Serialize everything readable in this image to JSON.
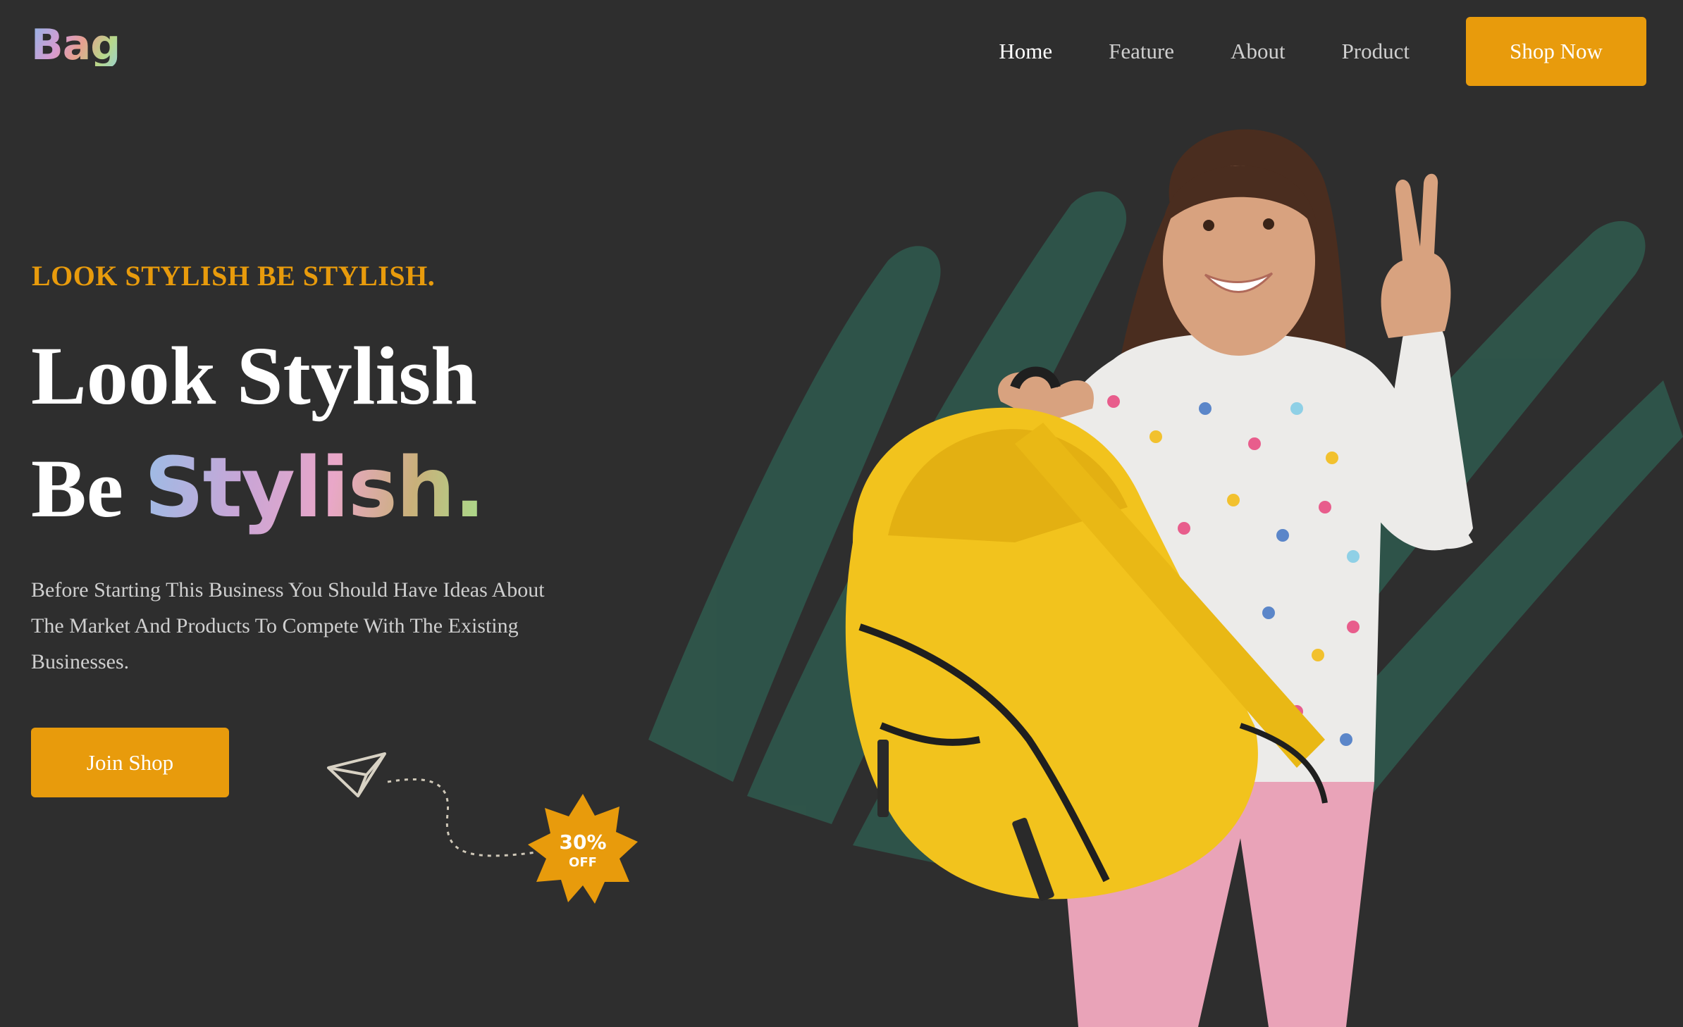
{
  "brand": {
    "logo_text": "Bag"
  },
  "nav": {
    "items": [
      {
        "label": "Home",
        "active": true
      },
      {
        "label": "Feature",
        "active": false
      },
      {
        "label": "About",
        "active": false
      },
      {
        "label": "Product",
        "active": false
      }
    ],
    "cta_label": "Shop Now"
  },
  "hero": {
    "eyebrow": "LOOK STYLISH BE STYLISH.",
    "headline_line1": "Look Stylish",
    "headline_line2_prefix": "Be",
    "headline_line2_gradient": "Stylish.",
    "description": "Before Starting This Business You Should Have Ideas About The Market And Products To Compete With The Existing Businesses.",
    "join_label": "Join Shop",
    "badge": {
      "percent": "30%",
      "label": "OFF"
    }
  },
  "colors": {
    "background": "#2e2e2e",
    "accent": "#e89b0c",
    "brush": "#2f5a4e",
    "backpack": "#f2c31d"
  },
  "icons": [
    "paper-plane-icon",
    "discount-star-icon"
  ]
}
